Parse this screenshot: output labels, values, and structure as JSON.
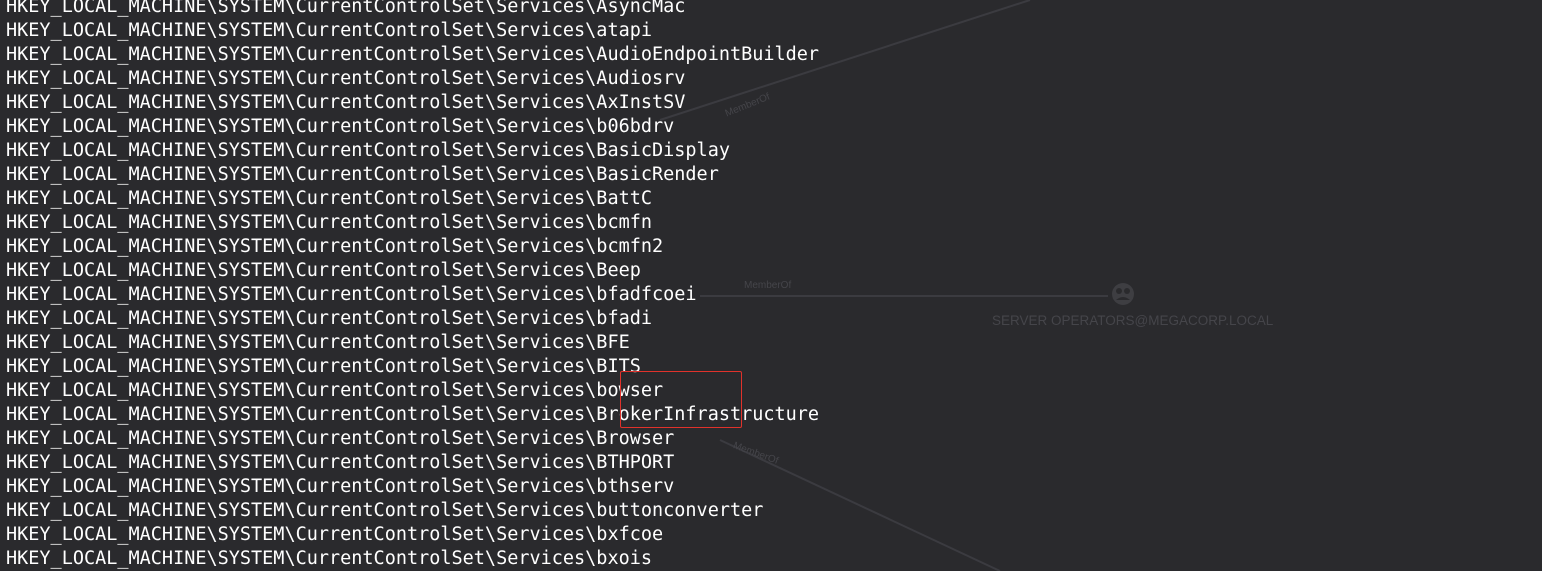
{
  "terminal": {
    "lines": [
      "HKEY_LOCAL_MACHINE\\SYSTEM\\CurrentControlSet\\Services\\AsyncMac",
      "HKEY_LOCAL_MACHINE\\SYSTEM\\CurrentControlSet\\Services\\atapi",
      "HKEY_LOCAL_MACHINE\\SYSTEM\\CurrentControlSet\\Services\\AudioEndpointBuilder",
      "HKEY_LOCAL_MACHINE\\SYSTEM\\CurrentControlSet\\Services\\Audiosrv",
      "HKEY_LOCAL_MACHINE\\SYSTEM\\CurrentControlSet\\Services\\AxInstSV",
      "HKEY_LOCAL_MACHINE\\SYSTEM\\CurrentControlSet\\Services\\b06bdrv",
      "HKEY_LOCAL_MACHINE\\SYSTEM\\CurrentControlSet\\Services\\BasicDisplay",
      "HKEY_LOCAL_MACHINE\\SYSTEM\\CurrentControlSet\\Services\\BasicRender",
      "HKEY_LOCAL_MACHINE\\SYSTEM\\CurrentControlSet\\Services\\BattC",
      "HKEY_LOCAL_MACHINE\\SYSTEM\\CurrentControlSet\\Services\\bcmfn",
      "HKEY_LOCAL_MACHINE\\SYSTEM\\CurrentControlSet\\Services\\bcmfn2",
      "HKEY_LOCAL_MACHINE\\SYSTEM\\CurrentControlSet\\Services\\Beep",
      "HKEY_LOCAL_MACHINE\\SYSTEM\\CurrentControlSet\\Services\\bfadfcoei",
      "HKEY_LOCAL_MACHINE\\SYSTEM\\CurrentControlSet\\Services\\bfadi",
      "HKEY_LOCAL_MACHINE\\SYSTEM\\CurrentControlSet\\Services\\BFE",
      "HKEY_LOCAL_MACHINE\\SYSTEM\\CurrentControlSet\\Services\\BITS",
      "HKEY_LOCAL_MACHINE\\SYSTEM\\CurrentControlSet\\Services\\bowser",
      "HKEY_LOCAL_MACHINE\\SYSTEM\\CurrentControlSet\\Services\\BrokerInfrastructure",
      "HKEY_LOCAL_MACHINE\\SYSTEM\\CurrentControlSet\\Services\\Browser",
      "HKEY_LOCAL_MACHINE\\SYSTEM\\CurrentControlSet\\Services\\BTHPORT",
      "HKEY_LOCAL_MACHINE\\SYSTEM\\CurrentControlSet\\Services\\bthserv",
      "HKEY_LOCAL_MACHINE\\SYSTEM\\CurrentControlSet\\Services\\buttonconverter",
      "HKEY_LOCAL_MACHINE\\SYSTEM\\CurrentControlSet\\Services\\bxfcoe",
      "HKEY_LOCAL_MACHINE\\SYSTEM\\CurrentControlSet\\Services\\bxois"
    ]
  },
  "graph_overlay": {
    "node_label": "SERVER OPERATORS@MEGACORP.LOCAL",
    "node_icon": "group-icon",
    "edge_labels": [
      "MemberOf",
      "MemberOf",
      "MemberOf"
    ]
  },
  "colors": {
    "background": "#2a2a2d",
    "text": "#ffffff",
    "highlight": "#e0322b",
    "graph_faint": "#45454a"
  }
}
